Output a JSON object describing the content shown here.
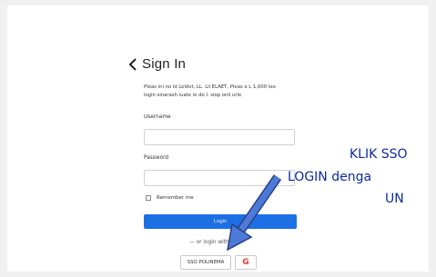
{
  "signin": {
    "title": "Sign In",
    "intro_line1": "Pleas ini no ld Leldvt, LL. Lil ELAET, Pleas o L 1,000 loo",
    "intro_line2": "login sinarash iuate le do l. siop onli urle",
    "username_label": "Username",
    "password_label": "Password",
    "remember_label": "Remember me",
    "login_button": "Login",
    "or_sep": "— or login with —",
    "sso_button": "SSO POLINEMA",
    "google_glyph": "G"
  },
  "annotation": {
    "line1": "KLIK SSO",
    "line2": "LOGIN denga",
    "line3": "UN"
  }
}
